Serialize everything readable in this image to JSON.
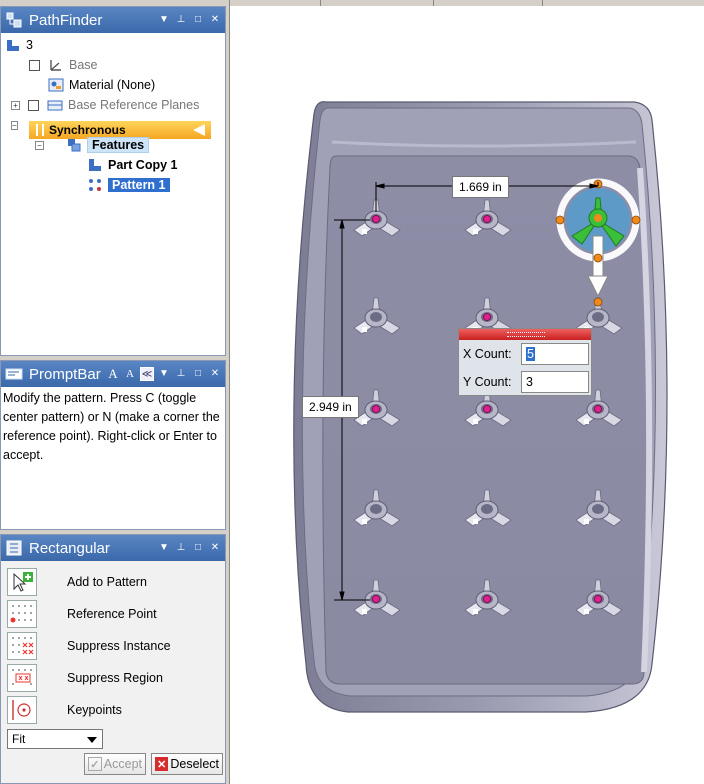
{
  "pathfinder": {
    "title": "PathFinder",
    "items": [
      {
        "label": "3"
      },
      {
        "label": "Base"
      },
      {
        "label": "Material (None)"
      },
      {
        "label": "Base Reference Planes"
      },
      {
        "label": "Synchronous"
      },
      {
        "label": "Features"
      },
      {
        "label": "Part Copy 1"
      },
      {
        "label": "Pattern 1"
      }
    ]
  },
  "promptbar": {
    "title": "PromptBar",
    "text": "Modify the pattern.  Press C (toggle center pattern) or N (make a corner the reference point).  Right-click or Enter to accept."
  },
  "rectangular": {
    "title": "Rectangular",
    "commands": [
      {
        "label": "Add to Pattern",
        "icon": "add-to-pattern-icon"
      },
      {
        "label": "Reference Point",
        "icon": "reference-point-icon"
      },
      {
        "label": "Suppress Instance",
        "icon": "suppress-instance-icon"
      },
      {
        "label": "Suppress Region",
        "icon": "suppress-region-icon"
      },
      {
        "label": "Keypoints",
        "icon": "keypoints-icon"
      }
    ],
    "fit_value": "Fit",
    "accept_label": "Accept",
    "deselect_label": "Deselect"
  },
  "canvas": {
    "dim_horizontal": "1.669 in",
    "dim_vertical": "2.949 in",
    "pattern_dialog": {
      "x_count_label": "X Count:",
      "x_count_value": "5",
      "y_count_label": "Y Count:",
      "y_count_value": "3"
    }
  },
  "colors": {
    "header_blue": "#4a78b8",
    "sync_orange": "#f5a623",
    "selection_blue": "#2f6fcf",
    "tray_gray": "#8c8ca3",
    "handle_orange": "#f08a1c",
    "steering_green": "#3bbf3b"
  }
}
